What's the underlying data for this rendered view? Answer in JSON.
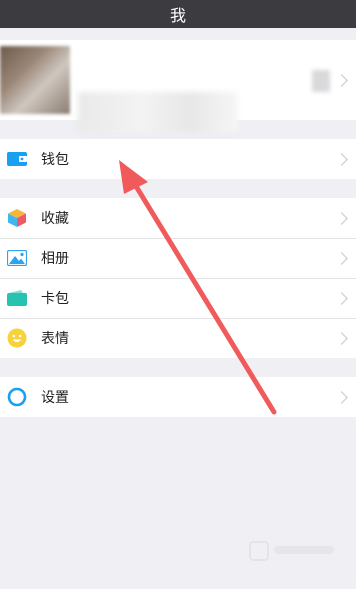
{
  "header": {
    "title": "我"
  },
  "profile": {
    "chevron": "chevron-right-icon"
  },
  "groups": [
    {
      "items": [
        {
          "label": "钱包",
          "icon": "wallet-icon"
        }
      ]
    },
    {
      "items": [
        {
          "label": "收藏",
          "icon": "favorites-cube-icon"
        },
        {
          "label": "相册",
          "icon": "album-icon"
        },
        {
          "label": "卡包",
          "icon": "card-wallet-icon"
        },
        {
          "label": "表情",
          "icon": "emoji-icon"
        }
      ]
    },
    {
      "items": [
        {
          "label": "设置",
          "icon": "settings-gear-icon"
        }
      ]
    }
  ],
  "colors": {
    "topbar": "#3b3b40",
    "accent_blue": "#1aa0f0",
    "arrow": "#f05a5a",
    "background": "#efeff4"
  }
}
